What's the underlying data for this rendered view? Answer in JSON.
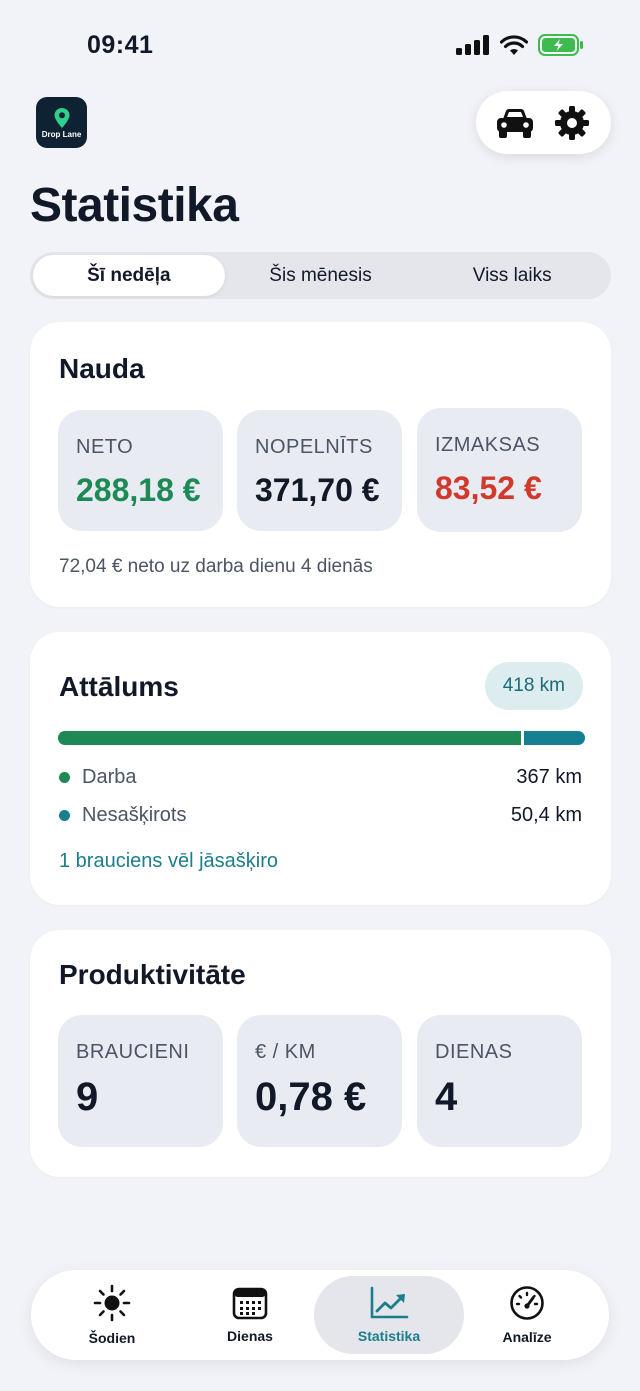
{
  "status_bar": {
    "time": "09:41"
  },
  "app": {
    "logo_text": "Drop Lane"
  },
  "page": {
    "title": "Statistika"
  },
  "segmented": {
    "tabs": [
      "Šī nedēļa",
      "Šis mēnesis",
      "Viss laiks"
    ],
    "active_index": 0
  },
  "money": {
    "title": "Nauda",
    "tiles": [
      {
        "label": "NETO",
        "value": "288,18 €",
        "color": "#1d8a55"
      },
      {
        "label": "NOPELNĪTS",
        "value": "371,70 €",
        "color": "#111827"
      },
      {
        "label": "IZMAKSAS",
        "value": "83,52 €",
        "color": "#d1392b"
      }
    ],
    "note": "72,04 € neto uz darba dienu 4 dienās"
  },
  "distance": {
    "title": "Attālums",
    "total": "418 km",
    "work_fraction": 0.879,
    "legend": [
      {
        "label": "Darba",
        "value": "367 km",
        "color": "#1d8a55"
      },
      {
        "label": "Nesašķirots",
        "value": "50,4 km",
        "color": "#167f91"
      }
    ],
    "link": "1 brauciens vēl jāsašķiro"
  },
  "productivity": {
    "title": "Produktivitāte",
    "tiles": [
      {
        "label": "BRAUCIENI",
        "value": "9"
      },
      {
        "label": "€ / KM",
        "value": "0,78 €"
      },
      {
        "label": "DIENAS",
        "value": "4"
      }
    ]
  },
  "nav": {
    "items": [
      {
        "label": "Šodien",
        "icon": "sun-icon"
      },
      {
        "label": "Dienas",
        "icon": "calendar-icon"
      },
      {
        "label": "Statistika",
        "icon": "chart-icon"
      },
      {
        "label": "Analīze",
        "icon": "gauge-icon"
      }
    ],
    "active_index": 2
  },
  "colors": {
    "accent": "#1c7d8c",
    "positive": "#1d8a55",
    "negative": "#d1392b"
  }
}
